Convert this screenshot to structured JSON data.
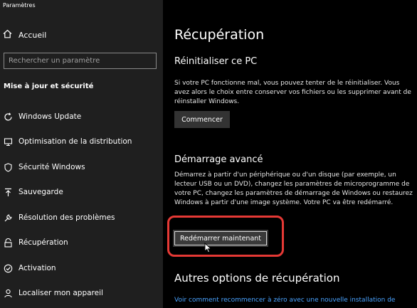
{
  "window": {
    "title": "Paramètres"
  },
  "sidebar": {
    "home_label": "Accueil",
    "search_placeholder": "Rechercher un paramètre",
    "section_title": "Mise à jour et sécurité",
    "items": [
      {
        "label": "Windows Update",
        "icon": "refresh-icon"
      },
      {
        "label": "Optimisation de la distribution",
        "icon": "delivery-optimization-icon"
      },
      {
        "label": "Sécurité Windows",
        "icon": "shield-icon"
      },
      {
        "label": "Sauvegarde",
        "icon": "backup-arrow-icon"
      },
      {
        "label": "Résolution des problèmes",
        "icon": "wrench-icon"
      },
      {
        "label": "Récupération",
        "icon": "recovery-icon"
      },
      {
        "label": "Activation",
        "icon": "check-circle-icon"
      },
      {
        "label": "Localiser mon appareil",
        "icon": "person-location-icon"
      }
    ]
  },
  "main": {
    "title": "Récupération",
    "reset": {
      "heading": "Réinitialiser ce PC",
      "description": "Si votre PC fonctionne mal, vous pouvez tenter de le réinitialiser. Vous avez alors le choix entre conserver vos fichiers ou les supprimer avant de réinstaller Windows.",
      "button": "Commencer"
    },
    "advanced": {
      "heading": "Démarrage avancé",
      "description": "Démarrez à partir d'un périphérique ou d'un disque (par exemple, un lecteur USB ou un DVD), changez les paramètres de microprogramme de votre PC, changez les paramètres de démarrage de Windows ou restaurez Windows à partir d'une image système. Votre PC va être redémarré.",
      "button": "Redémarrer maintenant"
    },
    "other": {
      "heading": "Autres options de récupération",
      "link": "Voir comment recommencer à zéro avec une nouvelle installation de"
    }
  },
  "colors": {
    "highlight": "#e53935",
    "link": "#4aa3ff",
    "sidebar_bg": "#1f1f1f",
    "main_bg": "#000000"
  }
}
